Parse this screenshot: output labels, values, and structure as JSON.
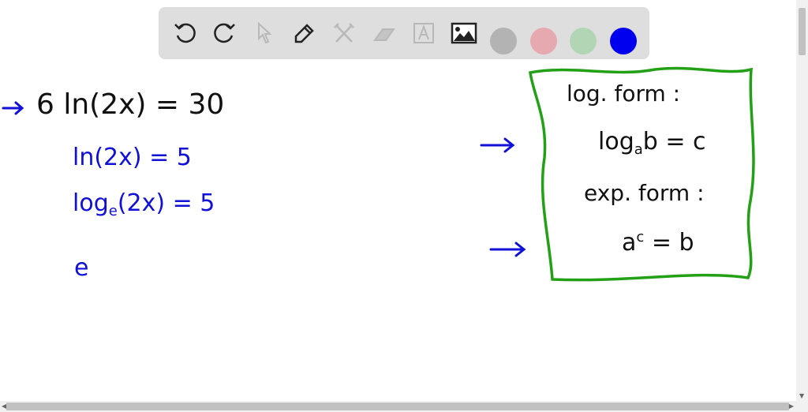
{
  "toolbar": {
    "tools": [
      "undo-icon",
      "redo-icon",
      "select-icon",
      "pen-icon",
      "tools-icon",
      "eraser-icon",
      "text-icon",
      "image-icon"
    ],
    "colors": [
      "#b3b3b3",
      "#e6a9b0",
      "#b2d6b4",
      "#0000ee"
    ]
  },
  "work": {
    "line1": "6 ln(2x) = 30",
    "line2": "ln(2x) = 5",
    "line3_pre": "log",
    "line3_sub": "e",
    "line3_post": "(2x) = 5",
    "line4": "e"
  },
  "box": {
    "log_label": "log. form :",
    "log_pre": "log",
    "log_sub": "a",
    "log_post": "b = c",
    "exp_label": "exp. form :",
    "exp_base": "a",
    "exp_sup": "c",
    "exp_post": " = b"
  },
  "colors": {
    "ink": "#111111",
    "blue": "#1010d8",
    "green": "#22a016"
  }
}
